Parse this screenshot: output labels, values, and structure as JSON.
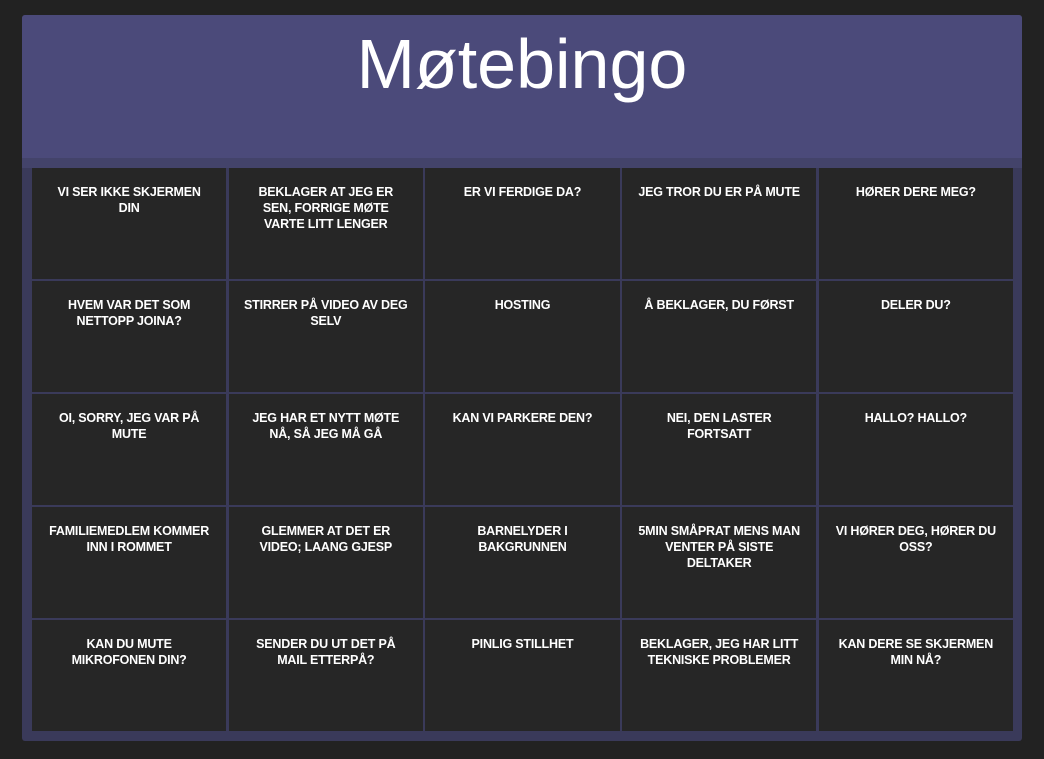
{
  "header": {
    "title": "Møtebingo"
  },
  "board": {
    "cells": [
      "Vi ser ikke skjermen din",
      "Beklager at jeg er sen, forrige møte varte litt lenger",
      "Er vi ferdige da?",
      "Jeg tror du er på mute",
      "Hører dere meg?",
      "Hvem var det som nettopp joina?",
      "Stirrer på video av deg selv",
      "Hosting",
      "Å beklager, du først",
      "Deler du?",
      "Oi, sorry, jeg var på mute",
      "Jeg har et nytt møte nå, så jeg må gå",
      "Kan vi parkere den?",
      "Nei, den laster fortsatt",
      "Hallo? Hallo?",
      "Familiemedlem kommer inn i rommet",
      "Glemmer at det er video; laang gjesp",
      "Barnelyder i bakgrunnen",
      "5min småprat mens man venter på siste deltaker",
      "Vi hører deg, hører du oss?",
      "Kan du mute mikrofonen din?",
      "Sender du ut det på mail etterpå?",
      "Pinlig stillhet",
      "Beklager, jeg har litt tekniske problemer",
      "Kan dere se skjermen min nå?"
    ]
  }
}
